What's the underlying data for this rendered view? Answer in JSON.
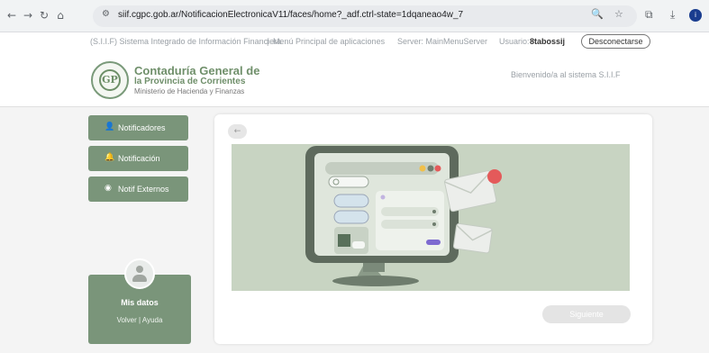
{
  "browser": {
    "url": "siif.cgpc.gob.ar/NotificacionElectronicaV11/faces/home?_adf.ctrl-state=1dqaneao4w_7",
    "profile_initial": "i"
  },
  "header": {
    "system_name": "(S.I.I.F) Sistema Integrado de Información Financiera",
    "separator": "|",
    "menu_link": "Menú Principal de aplicaciones",
    "server": "Server: MainMenuServer",
    "user_label": "Usuario:",
    "user_name": "8tabossij",
    "logout_label": "Desconectarse"
  },
  "org": {
    "line1": "Contaduría General de",
    "line2": "la Provincia de Corrientes",
    "line3": "Ministerio de Hacienda y Finanzas",
    "logo_text": "GP"
  },
  "welcome": "Bienvenido/a al sistema S.I.I.F",
  "sidebar": {
    "items": [
      {
        "label": "Notificadores"
      },
      {
        "label": "Notificación"
      },
      {
        "label": "Notif Externos"
      }
    ]
  },
  "profile": {
    "title": "Mis datos",
    "back_link": "Volver",
    "link_separator": "|",
    "help_link": "Ayuda"
  },
  "main": {
    "next_label": "Siguiente"
  },
  "colors": {
    "accent": "#7a957a",
    "illustration_bg": "#c8d4c2",
    "notification_dot": "#e45a5a"
  },
  "icons": {
    "back": "arrow-left-icon",
    "user": "user-icon",
    "bell": "bell-icon",
    "circle": "circle-icon"
  }
}
